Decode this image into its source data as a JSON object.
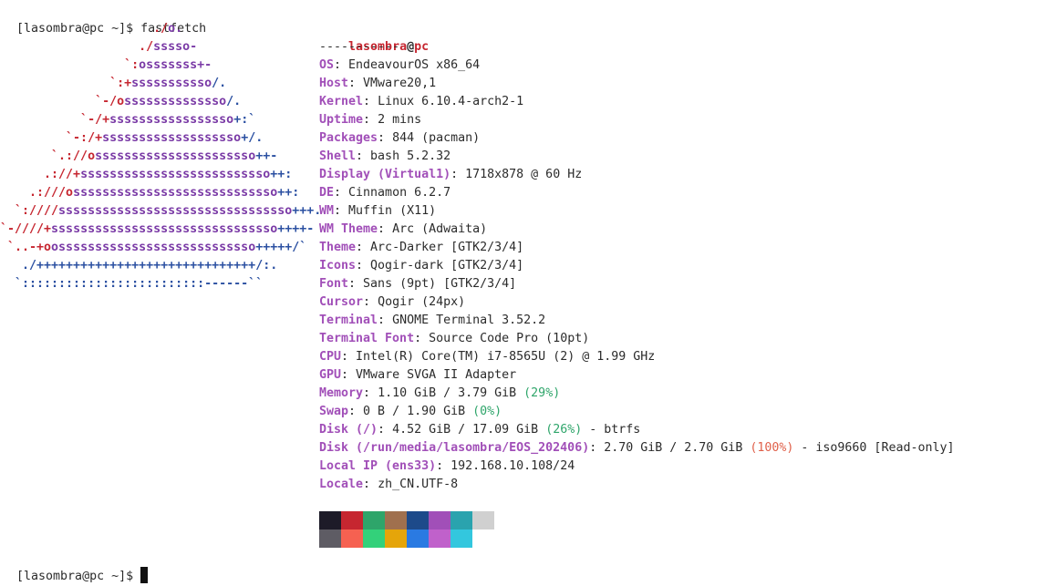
{
  "prompt_top": {
    "prompt": "[lasombra@pc ~]$ ",
    "command": "fastfetch"
  },
  "logo_colors": {
    "red": "#c62630",
    "blue": "#2a4fa1",
    "purple": "#7a3aa6"
  },
  "logo_rows": [
    [
      {
        "t": "                     ./",
        "c": "red"
      },
      {
        "t": "o.",
        "c": "purple"
      }
    ],
    [
      {
        "t": "                   ./",
        "c": "red"
      },
      {
        "t": "sssso-",
        "c": "purple"
      }
    ],
    [
      {
        "t": "                 `:",
        "c": "red"
      },
      {
        "t": "osssssss+-",
        "c": "purple"
      }
    ],
    [
      {
        "t": "               `:+",
        "c": "red"
      },
      {
        "t": "sssssssssso",
        "c": "purple"
      },
      {
        "t": "/.",
        "c": "blue"
      }
    ],
    [
      {
        "t": "             `-/o",
        "c": "red"
      },
      {
        "t": "ssssssssssssso",
        "c": "purple"
      },
      {
        "t": "/.",
        "c": "blue"
      }
    ],
    [
      {
        "t": "           `-/+",
        "c": "red"
      },
      {
        "t": "sssssssssssssssso",
        "c": "purple"
      },
      {
        "t": "+:`",
        "c": "blue"
      }
    ],
    [
      {
        "t": "         `-:/+",
        "c": "red"
      },
      {
        "t": "sssssssssssssssssso",
        "c": "purple"
      },
      {
        "t": "+/.",
        "c": "blue"
      }
    ],
    [
      {
        "t": "       `.://o",
        "c": "red"
      },
      {
        "t": "ssssssssssssssssssssso",
        "c": "purple"
      },
      {
        "t": "++-",
        "c": "blue"
      }
    ],
    [
      {
        "t": "      .://+",
        "c": "red"
      },
      {
        "t": "ssssssssssssssssssssssssso",
        "c": "purple"
      },
      {
        "t": "++:",
        "c": "blue"
      }
    ],
    [
      {
        "t": "    .:///o",
        "c": "red"
      },
      {
        "t": "ssssssssssssssssssssssssssso",
        "c": "purple"
      },
      {
        "t": "++:",
        "c": "blue"
      }
    ],
    [
      {
        "t": "  `:////",
        "c": "red"
      },
      {
        "t": "ssssssssssssssssssssssssssssssso",
        "c": "purple"
      },
      {
        "t": "+++.",
        "c": "blue"
      }
    ],
    [
      {
        "t": "`-////+",
        "c": "red"
      },
      {
        "t": "sssssssssssssssssssssssssssssso",
        "c": "purple"
      },
      {
        "t": "++++-",
        "c": "blue"
      }
    ],
    [
      {
        "t": " `..-+o",
        "c": "red"
      },
      {
        "t": "osssssssssssssssssssssssssso",
        "c": "purple"
      },
      {
        "t": "+++++/`",
        "c": "blue"
      }
    ],
    [
      {
        "t": "   ./++++++++++++++++++++++++++++++/:.",
        "c": "blue"
      }
    ],
    [
      {
        "t": "  `:::::::::::::::::::::::::------``",
        "c": "blue"
      }
    ]
  ],
  "title": {
    "user": "lasombra",
    "at": "@",
    "host": "pc",
    "separator": "-----------"
  },
  "info": [
    {
      "key": "OS",
      "value": "EndeavourOS x86_64"
    },
    {
      "key": "Host",
      "value": "VMware20,1"
    },
    {
      "key": "Kernel",
      "value": "Linux 6.10.4-arch2-1"
    },
    {
      "key": "Uptime",
      "value": "2 mins"
    },
    {
      "key": "Packages",
      "value": "844 (pacman)"
    },
    {
      "key": "Shell",
      "value": "bash 5.2.32"
    },
    {
      "key": "Display (Virtual1)",
      "value": "1718x878 @ 60 Hz"
    },
    {
      "key": "DE",
      "value": "Cinnamon 6.2.7"
    },
    {
      "key": "WM",
      "value": "Muffin (X11)"
    },
    {
      "key": "WM Theme",
      "value": "Arc (Adwaita)"
    },
    {
      "key": "Theme",
      "value": "Arc-Darker [GTK2/3/4]"
    },
    {
      "key": "Icons",
      "value": "Qogir-dark [GTK2/3/4]"
    },
    {
      "key": "Font",
      "value": "Sans (9pt) [GTK2/3/4]"
    },
    {
      "key": "Cursor",
      "value": "Qogir (24px)"
    },
    {
      "key": "Terminal",
      "value": "GNOME Terminal 3.52.2"
    },
    {
      "key": "Terminal Font",
      "value": "Source Code Pro (10pt)"
    },
    {
      "key": "CPU",
      "value": "Intel(R) Core(TM) i7-8565U (2) @ 1.99 GHz"
    },
    {
      "key": "GPU",
      "value": "VMware SVGA II Adapter"
    },
    {
      "key": "Memory",
      "value": "1.10 GiB / 3.79 GiB ",
      "pct": "(29%)",
      "pct_color": "green"
    },
    {
      "key": "Swap",
      "value": "0 B / 1.90 GiB ",
      "pct": "(0%)",
      "pct_color": "green"
    },
    {
      "key": "Disk (/)",
      "value": "4.52 GiB / 17.09 GiB ",
      "pct": "(26%)",
      "pct_color": "green",
      "tail": " - btrfs"
    },
    {
      "key": "Disk (/run/media/lasombra/EOS_202406)",
      "value": "2.70 GiB / 2.70 GiB ",
      "pct": "(100%)",
      "pct_color": "red",
      "tail": " - iso9660 [Read-only]"
    },
    {
      "key": "Local IP (ens33)",
      "value": "192.168.10.108/24"
    },
    {
      "key": "Locale",
      "value": "zh_CN.UTF-8"
    }
  ],
  "palette": {
    "top": [
      "#1d1b28",
      "#c62630",
      "#2ea56a",
      "#a0704e",
      "#1d4a8a",
      "#a14fb8",
      "#2aa3ae",
      "#d0d0d0"
    ],
    "bottom": [
      "#5e5c64",
      "#f66151",
      "#33d17a",
      "#e5a50a",
      "#2a7ae2",
      "#c061cb",
      "#33c7de"
    ]
  },
  "prompt_bottom": {
    "prompt": "[lasombra@pc ~]$ "
  }
}
